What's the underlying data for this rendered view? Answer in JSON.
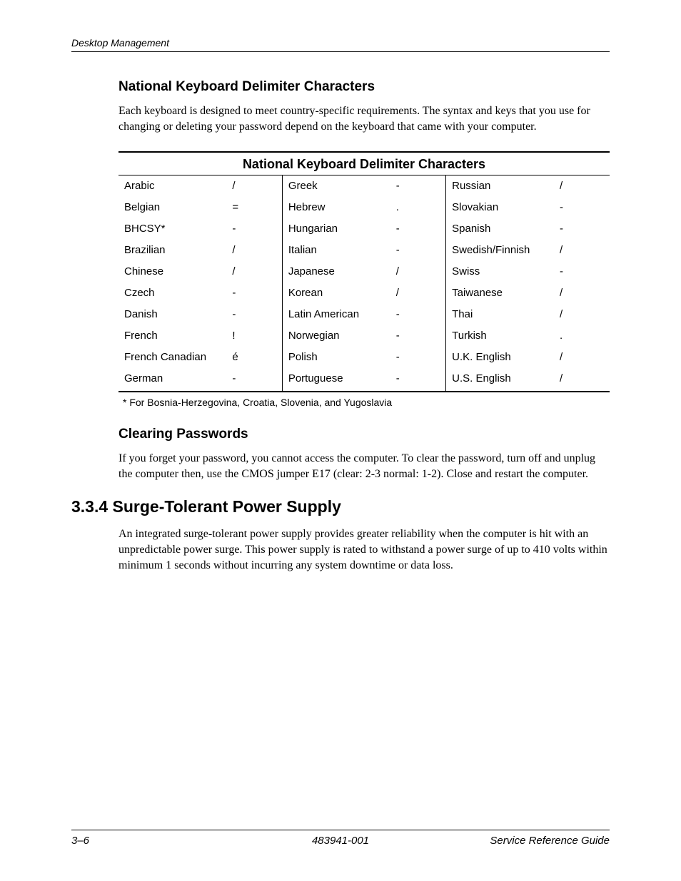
{
  "header": "Desktop Management",
  "section1": {
    "heading": "National Keyboard Delimiter Characters",
    "para": "Each keyboard is designed to meet country-specific requirements. The syntax and keys that you use for changing or deleting your password depend on the keyboard that came with your computer."
  },
  "table": {
    "title": "National Keyboard Delimiter Characters",
    "rows": [
      {
        "c1l": "Arabic",
        "c1d": "/",
        "c2l": "Greek",
        "c2d": "-",
        "c3l": "Russian",
        "c3d": "/"
      },
      {
        "c1l": "Belgian",
        "c1d": "=",
        "c2l": "Hebrew",
        "c2d": ".",
        "c3l": "Slovakian",
        "c3d": "-"
      },
      {
        "c1l": "BHCSY*",
        "c1d": "-",
        "c2l": "Hungarian",
        "c2d": "-",
        "c3l": "Spanish",
        "c3d": "-"
      },
      {
        "c1l": "Brazilian",
        "c1d": "/",
        "c2l": "Italian",
        "c2d": "-",
        "c3l": "Swedish/Finnish",
        "c3d": "/"
      },
      {
        "c1l": "Chinese",
        "c1d": "/",
        "c2l": "Japanese",
        "c2d": "/",
        "c3l": "Swiss",
        "c3d": "-"
      },
      {
        "c1l": "Czech",
        "c1d": "-",
        "c2l": "Korean",
        "c2d": "/",
        "c3l": "Taiwanese",
        "c3d": "/"
      },
      {
        "c1l": "Danish",
        "c1d": "-",
        "c2l": "Latin American",
        "c2d": "-",
        "c3l": "Thai",
        "c3d": "/"
      },
      {
        "c1l": "French",
        "c1d": "!",
        "c2l": "Norwegian",
        "c2d": "-",
        "c3l": "Turkish",
        "c3d": "."
      },
      {
        "c1l": "French Canadian",
        "c1d": "é",
        "c2l": "Polish",
        "c2d": "-",
        "c3l": "U.K. English",
        "c3d": "/"
      },
      {
        "c1l": "German",
        "c1d": "-",
        "c2l": "Portuguese",
        "c2d": "-",
        "c3l": "U.S. English",
        "c3d": "/"
      }
    ],
    "footnote": "* For Bosnia-Herzegovina, Croatia, Slovenia, and Yugoslavia"
  },
  "section2": {
    "heading": "Clearing Passwords",
    "para": "If you forget your password, you cannot access the computer. To clear the password, turn off and unplug the computer then, use the CMOS jumper E17 (clear: 2-3 normal: 1-2). Close and restart the computer."
  },
  "section3": {
    "heading": "3.3.4 Surge-Tolerant Power Supply",
    "para": "An integrated surge-tolerant power supply provides greater reliability when the computer is hit with an unpredictable power surge. This power supply is rated to withstand a power surge of up to 410 volts within minimum 1 seconds without incurring any system downtime or data loss."
  },
  "footer": {
    "left": "3–6",
    "center": "483941-001",
    "right": "Service Reference Guide"
  }
}
